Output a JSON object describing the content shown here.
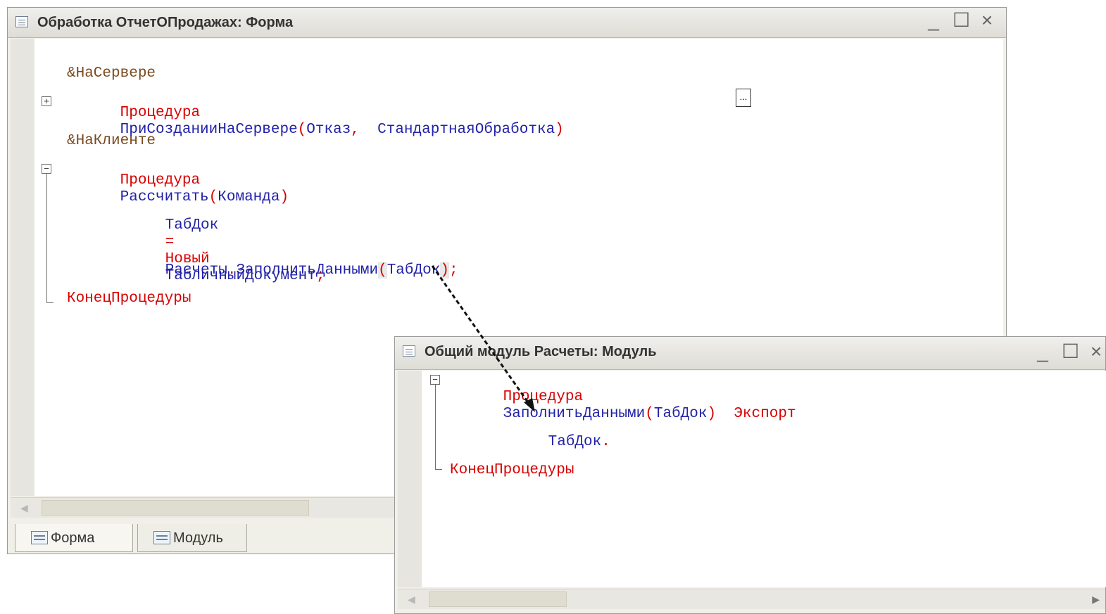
{
  "window1": {
    "title": "Обработка ОтчетОПродажах: Форма",
    "controls": {
      "minimize": "_",
      "maximize": "☐",
      "close": "×"
    },
    "code": {
      "line1": "&НаСервере",
      "line2_kw": "Процедура",
      "line2_name": "ПриСозданииНаСервере",
      "line2_paren_open": "(",
      "line2_arg1": "Отказ",
      "line2_comma": ",",
      "line2_arg2": "СтандартнаяОбработка",
      "line2_paren_close": ")",
      "line2_ellipsis": "...",
      "line3": "&НаКлиенте",
      "line4_kw": "Процедура",
      "line4_name": "Рассчитать",
      "line4_paren_open": "(",
      "line4_arg": "Команда",
      "line4_paren_close": ")",
      "line5_var": "ТабДок",
      "line5_eq": "=",
      "line5_new": "Новый",
      "line5_type": "ТабличныйДокумент",
      "line5_semi": ";",
      "line6_obj": "Расчеты",
      "line6_dot": ".",
      "line6_method": "ЗаполнитьДанными",
      "line6_paren_open": "(",
      "line6_arg": "ТабДок",
      "line6_paren_close": ")",
      "line6_semi": ";",
      "line7": "КонецПроцедуры"
    },
    "tabs": [
      {
        "label": "Форма"
      },
      {
        "label": "Модуль"
      }
    ]
  },
  "window2": {
    "title": "Общий модуль Расчеты: Модуль",
    "controls": {
      "minimize": "_",
      "maximize": "☐",
      "close": "×"
    },
    "code": {
      "line1_kw": "Процедура",
      "line1_name": "ЗаполнитьДанными",
      "line1_paren_open": "(",
      "line1_arg": "ТабДок",
      "line1_paren_close": ")",
      "line1_export": "Экспорт",
      "line2_var": "ТабДок",
      "line2_dot": ".",
      "line3": "КонецПроцедуры"
    }
  }
}
